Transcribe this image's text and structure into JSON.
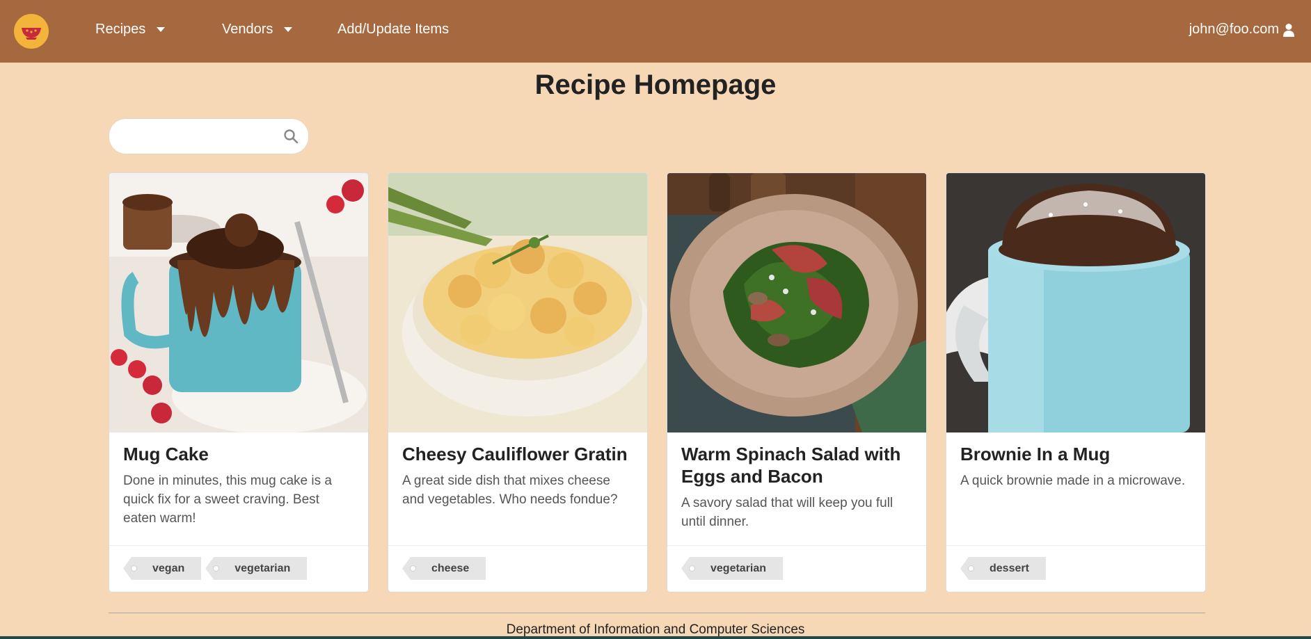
{
  "navbar": {
    "logo_icon": "bowl-icon",
    "items": [
      {
        "label": "Recipes",
        "has_dropdown": true
      },
      {
        "label": "Vendors",
        "has_dropdown": true
      },
      {
        "label": "Add/Update Items",
        "has_dropdown": false
      }
    ],
    "user": {
      "email": "john@foo.com",
      "icon": "user-icon"
    },
    "color": "#a5683f"
  },
  "page": {
    "title": "Recipe Homepage",
    "background": "#f6d7b6"
  },
  "search": {
    "value": "",
    "placeholder": "",
    "icon": "search-icon"
  },
  "cards": [
    {
      "title": "Mug Cake",
      "description": "Done in minutes, this mug cake is a quick fix for a sweet craving. Best eaten warm!",
      "image": "mug-cake-photo",
      "tags": [
        "vegan",
        "vegetarian"
      ]
    },
    {
      "title": "Cheesy Cauliflower Gratin",
      "description": "A great side dish that mixes cheese and vegetables. Who needs fondue?",
      "image": "cauliflower-gratin-photo",
      "tags": [
        "cheese"
      ]
    },
    {
      "title": "Warm Spinach Salad with Eggs and Bacon",
      "description": "A savory salad that will keep you full until dinner.",
      "image": "spinach-salad-photo",
      "tags": [
        "vegetarian"
      ]
    },
    {
      "title": "Brownie In a Mug",
      "description": "A quick brownie made in a microwave.",
      "image": "brownie-mug-photo",
      "tags": [
        "dessert"
      ]
    }
  ],
  "footer": {
    "text": "Department of Information and Computer Sciences"
  }
}
